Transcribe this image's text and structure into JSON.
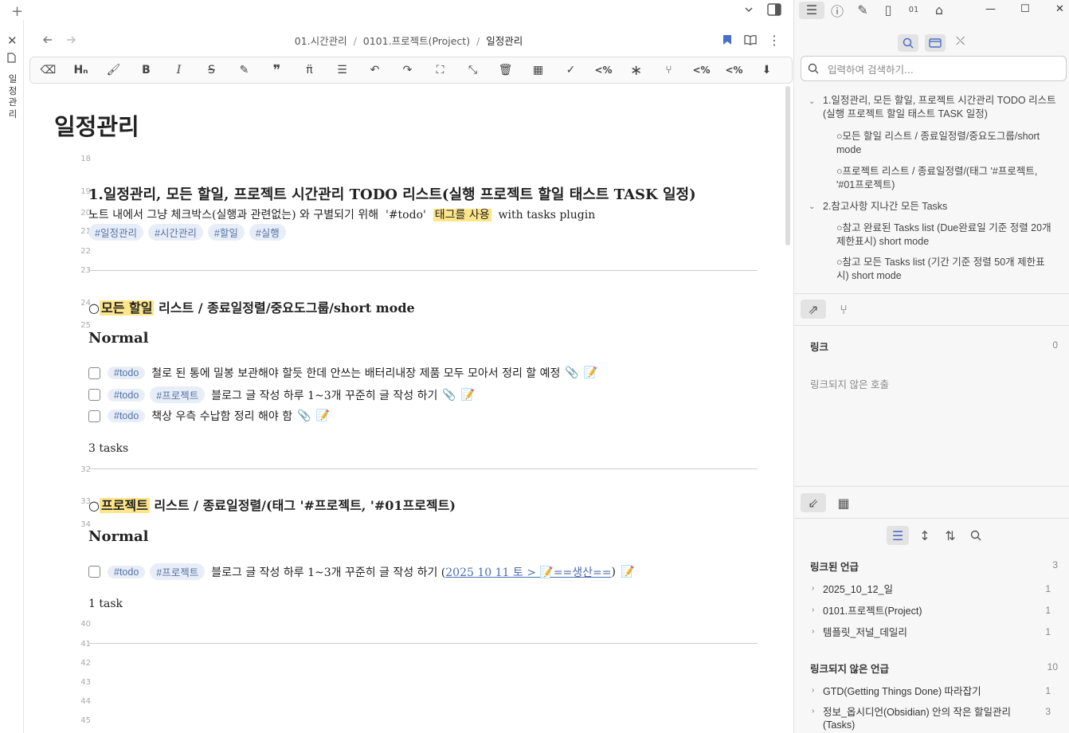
{
  "breadcrumb": {
    "part1": "01.시간관리",
    "sep1": "/",
    "part2": "0101.프로젝트(Project)",
    "sep2": "/",
    "current": "일정관리"
  },
  "vertical_tab": {
    "title": "일\n정\n관\n리"
  },
  "page": {
    "title": "일정관리",
    "lines": {
      "l18": "18",
      "l19": "19",
      "l20": "20",
      "l21": "21",
      "l22": "22",
      "l23": "23",
      "l24": "24",
      "l25": "25",
      "l32": "32",
      "l33": "33",
      "l34": "34",
      "l40": "40",
      "l41": "41",
      "l42": "42",
      "l43": "43",
      "l44": "44",
      "l45": "45"
    },
    "heading1": "1.일정관리, 모든 할일, 프로젝트 시간관리 TODO 리스트(실행 프로젝트 할일 태스트 TASK 일정)",
    "para": {
      "pre": "노트 내에서 그냥 체크박스(실행과 관련없는) 와 구별되기 위해  '#todo'  ",
      "highlight": "태그를 사용",
      "post": "  with tasks plugin"
    },
    "tags": [
      "#일정관리",
      "#시간관리",
      "#할일",
      "#실행"
    ],
    "section1": {
      "prefix": "○",
      "highlight": "모든 할일",
      "rest": " 리스트 / 종료일정렬/중요도그룹/short mode",
      "group": "Normal",
      "count": "3 tasks"
    },
    "section2": {
      "prefix": "○",
      "highlight": "프로젝트",
      "rest": " 리스트 / 종료일정렬/(태그 '#프로젝트, '#01프로젝트)",
      "group": "Normal",
      "count": "1 task"
    },
    "tasks1": [
      {
        "tag1": "#todo",
        "text": "철로 된 통에 밀봉 보관해야 할듯 한데 안쓰는 배터리내장 제품 모두 모아서 정리 할 예정"
      },
      {
        "tag1": "#todo",
        "tag2": "#프로젝트",
        "text": "블로그 글 작성 하루 1~3개 꾸준히 글 작성 하기"
      },
      {
        "tag1": "#todo",
        "text": "책상 우측 수납함 정리 해야 함"
      }
    ],
    "tasks2": [
      {
        "tag1": "#todo",
        "tag2": "#프로젝트",
        "text": "블로그 글 작성 하루 1~3개 꾸준히 글 작성 하기 (",
        "link": "2025 10 11 토 > 📝==생산==",
        "close": ")"
      }
    ],
    "emoji": {
      "clip": "📎",
      "memo": "📝"
    }
  },
  "sidebar": {
    "search_placeholder": "입력하여 검색하기...",
    "outline": {
      "h1a": "1.일정관리, 모든 할일, 프로젝트 시간관리 TODO 리스트(실행 프로젝트 할일 태스트 TASK 일정)",
      "h2a": "○모든 할일 리스트 / 종료일정렬/중요도그룹/short mode",
      "h2b": "○프로젝트 리스트 / 종료일정렬/(태그 '#프로젝트, '#01프로젝트)",
      "h1b": "2.참고사항 지나간 모든 Tasks",
      "h2c": "○참고 완료된 Tasks list (Due완료일 기준 정렬 20개 제한표시) short mode",
      "h2d": "○참고 모든 Tasks list (기간 기준 정렬 50개 제한표시) short mode"
    },
    "links": {
      "title": "링크",
      "count": "0",
      "unlinked_calls": "링크되지 않은 호출"
    },
    "backlinks": {
      "linked_title": "링크된 언급",
      "linked_count": "3",
      "linked": [
        {
          "name": "2025_10_12_일",
          "count": "1"
        },
        {
          "name": "0101.프로젝트(Project)",
          "count": "1"
        },
        {
          "name": "템플릿_저널_데일리",
          "count": "1"
        }
      ],
      "unlinked_title": "링크되지 않은 언급",
      "unlinked_count": "10",
      "unlinked": [
        {
          "name": "GTD(Getting Things Done) 따라잡기",
          "count": "1"
        },
        {
          "name": "정보_옵시디언(Obsidian) 안의 작은 할일관리(Tasks)",
          "count": "3"
        }
      ]
    }
  },
  "colors": {
    "highlight": "#fde68a",
    "tag_bg": "#e8eef8",
    "tag_text": "#5571a6",
    "link": "#4a6fb0"
  }
}
